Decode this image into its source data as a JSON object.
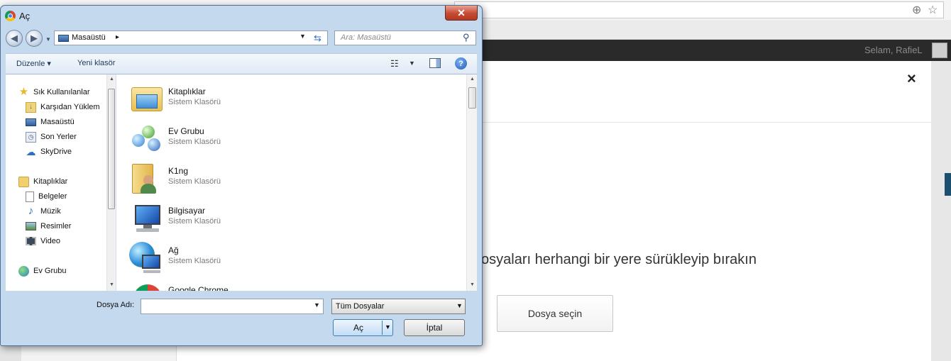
{
  "browser": {
    "user_greeting": "Selam, RafieL",
    "zoom_icon": "zoom-icon",
    "star_icon": "star-icon"
  },
  "modal": {
    "close_label": "×",
    "drop_text": "osyaları herhangi bir yere sürükleyip bırakın",
    "choose_button": "Dosya seçin"
  },
  "dialog": {
    "title": "Aç",
    "close_label": "✕",
    "address": {
      "location": "Masaüstü",
      "separator": "▸"
    },
    "search_placeholder": "Ara: Masaüstü",
    "toolbar": {
      "organize": "Düzenle ▾",
      "new_folder": "Yeni klasör",
      "help": "?"
    },
    "nav_items": [
      {
        "label": "Sık Kullanılanlar",
        "icon": "star-icon"
      },
      {
        "label": "Karşıdan Yüklem",
        "icon": "downloads-icon"
      },
      {
        "label": "Masaüstü",
        "icon": "desktop-icon"
      },
      {
        "label": "Son Yerler",
        "icon": "recent-places-icon"
      },
      {
        "label": "SkyDrive",
        "icon": "skydrive-icon"
      },
      {
        "label": "Kitaplıklar",
        "icon": "libraries-icon"
      },
      {
        "label": "Belgeler",
        "icon": "documents-icon"
      },
      {
        "label": "Müzik",
        "icon": "music-icon"
      },
      {
        "label": "Resimler",
        "icon": "pictures-icon"
      },
      {
        "label": "Video",
        "icon": "video-icon"
      },
      {
        "label": "Ev Grubu",
        "icon": "homegroup-icon"
      }
    ],
    "files": [
      {
        "name": "Kitaplıklar",
        "type": "Sistem Klasörü",
        "icon": "libraries-icon"
      },
      {
        "name": "Ev Grubu",
        "type": "Sistem Klasörü",
        "icon": "homegroup-icon"
      },
      {
        "name": "K1ng",
        "type": "Sistem Klasörü",
        "icon": "user-folder-icon"
      },
      {
        "name": "Bilgisayar",
        "type": "Sistem Klasörü",
        "icon": "computer-icon"
      },
      {
        "name": "Ağ",
        "type": "Sistem Klasörü",
        "icon": "network-icon"
      },
      {
        "name": "Google Chrome",
        "type": "",
        "icon": "chrome-icon"
      }
    ],
    "file_name_label": "Dosya Adı:",
    "file_name_value": "",
    "file_type": "Tüm Dosyalar",
    "open_button": "Aç",
    "cancel_button": "İptal"
  }
}
